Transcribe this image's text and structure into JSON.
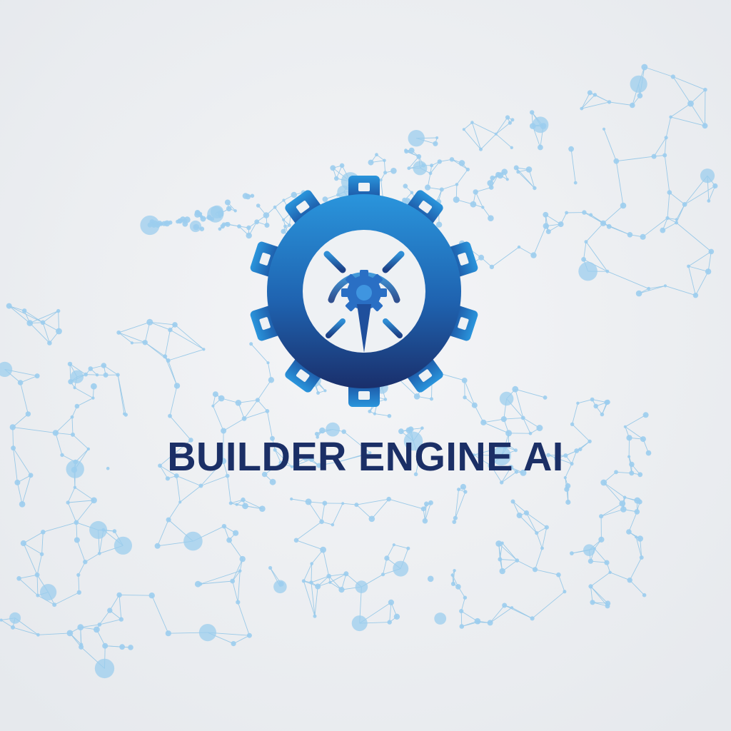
{
  "brand": {
    "name": "BUILDER ENGINE AI"
  },
  "logo": {
    "icon": "gear-with-compass-icon",
    "gradient_top": "#2a8fd8",
    "gradient_bottom": "#1a2f6b"
  },
  "background": {
    "color": "#eceef1",
    "network_line_color": "#8cc3e6",
    "network_dot_color": "#9ccdee"
  },
  "text_color": "#1b2f66"
}
